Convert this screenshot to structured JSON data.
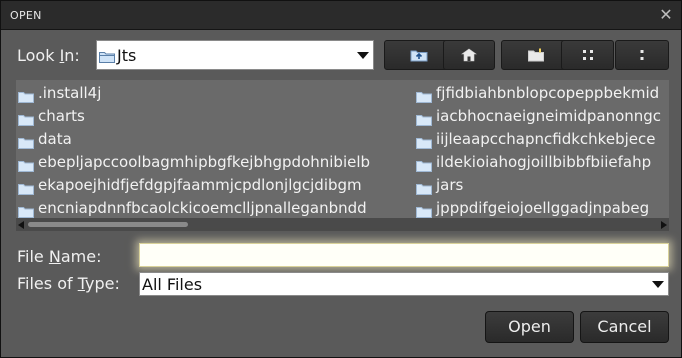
{
  "window": {
    "title": "OPEN",
    "close_icon": "close-icon"
  },
  "look_in": {
    "label_prefix": "Look ",
    "label_mnemonic": "I",
    "label_suffix": "n:",
    "value": "Jts"
  },
  "toolbar": {
    "buttons": [
      {
        "name": "up-one-level-button",
        "icon": "folder-up-icon"
      },
      {
        "name": "home-button",
        "icon": "home-icon"
      },
      {
        "name": "new-folder-button",
        "icon": "new-folder-icon"
      },
      {
        "name": "list-view-button",
        "icon": "list-view-icon"
      },
      {
        "name": "details-view-button",
        "icon": "details-view-icon"
      }
    ]
  },
  "file_list": {
    "column1": [
      ".install4j",
      "charts",
      "data",
      "ebepljapccoolbagmhipbgfkejbhgpdohnibielb",
      "ekapoejhidfjefdgpjfaammjcpdlonjlgcjdibgm",
      "encniapdnnfbcaolckicoemclljpnalleganbndd"
    ],
    "column2": [
      "fjfidbiahbnblopcopeppbekmid",
      "iacbhocnaeigneimidpanonngc",
      "iijleaapcchapncfidkchkebjece",
      "ildekioiahogjoillbibbfbiiefahp",
      "jars",
      "jpppdifgeiojoellggadjnpabeg"
    ]
  },
  "file_name": {
    "label_prefix": "File ",
    "label_mnemonic": "N",
    "label_suffix": "ame:",
    "value": ""
  },
  "file_type": {
    "label_prefix": "Files of ",
    "label_mnemonic": "T",
    "label_suffix": "ype:",
    "value": "All Files"
  },
  "actions": {
    "open_label": "Open",
    "cancel_label": "Cancel"
  },
  "colors": {
    "dialog_bg": "#5a5a5a",
    "titlebar_bg": "#2b2b2b",
    "list_bg": "#6a6a6a",
    "button_bg": "#2f2f2f",
    "folder_icon": "#d8e8f8"
  }
}
